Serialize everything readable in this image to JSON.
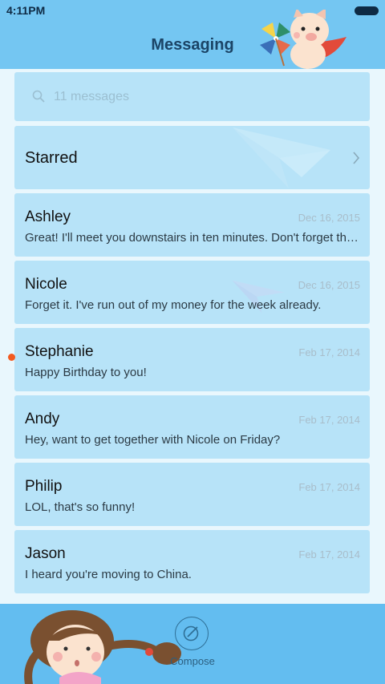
{
  "status_bar": {
    "time": "4:11PM"
  },
  "header": {
    "title": "Messaging"
  },
  "search": {
    "placeholder": "11 messages"
  },
  "starred": {
    "label": "Starred"
  },
  "conversations": [
    {
      "name": "Ashley",
      "date": "Dec 16, 2015",
      "preview": "Great! I'll meet you downstairs in ten minutes. Don't forget the tickets.",
      "unread": false
    },
    {
      "name": "Nicole",
      "date": "Dec 16, 2015",
      "preview": "Forget it. I've run out of my money for the week already.",
      "unread": false
    },
    {
      "name": "Stephanie",
      "date": "Feb 17, 2014",
      "preview": "Happy Birthday to you!",
      "unread": true
    },
    {
      "name": "Andy",
      "date": "Feb 17, 2014",
      "preview": "Hey, want to get together with Nicole on Friday?",
      "unread": false
    },
    {
      "name": "Philip",
      "date": "Feb 17, 2014",
      "preview": "LOL, that's so funny!",
      "unread": false
    },
    {
      "name": "Jason",
      "date": "Feb 17, 2014",
      "preview": "I heard you're moving to China.",
      "unread": false
    }
  ],
  "bottom_bar": {
    "compose_label": "Compose"
  },
  "colors": {
    "header": "#74c6f2",
    "card": "#b7e3f8",
    "unread_dot": "#f25a20",
    "bottom_bar": "#63bdf0"
  },
  "icons": [
    "search-icon",
    "chevron-right-icon",
    "compose-icon"
  ]
}
